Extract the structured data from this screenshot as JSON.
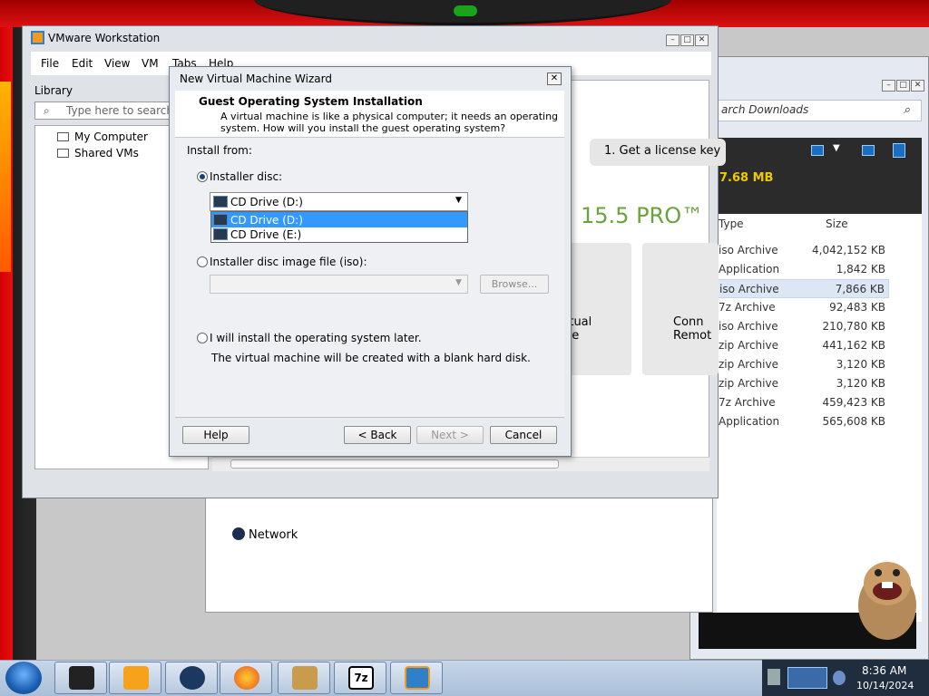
{
  "vmware": {
    "title": "VMware Workstation",
    "menu": [
      "File",
      "Edit",
      "View",
      "VM",
      "Tabs",
      "Help"
    ],
    "library_label": "Library",
    "search_placeholder": "Type here to search",
    "tree": [
      "My Computer",
      "Shared VMs"
    ],
    "home": {
      "license_button": "1. Get a license key",
      "product": "15.5 PRO™",
      "tile1": "rtual",
      "tile1_line2": "ne",
      "tile2": "Conn",
      "tile2_line2": "Remot"
    }
  },
  "wizard": {
    "title": "New Virtual Machine Wizard",
    "heading": "Guest Operating System Installation",
    "subtitle_line1": "A virtual machine is like a physical computer; it needs an operating",
    "subtitle_line2": "system. How will you install the guest operating system?",
    "install_from": "Install from:",
    "option_disc": "Installer disc:",
    "disc_selected": "CD Drive (D:)",
    "disc_options": [
      "CD Drive (D:)",
      "CD Drive (E:)"
    ],
    "option_iso": "Installer disc image file (iso):",
    "browse": "Browse...",
    "option_later": "I will install the operating system later.",
    "later_desc": "The virtual machine will be created with a blank hard disk.",
    "help": "Help",
    "back": "< Back",
    "next": "Next >",
    "cancel": "Cancel"
  },
  "explorer": {
    "search": "arch Downloads",
    "size_banner": "7.68 MB",
    "col_type": "Type",
    "col_size": "Size",
    "rows": [
      {
        "type": "iso Archive",
        "size": "4,042,152 KB"
      },
      {
        "type": "Application",
        "size": "1,842 KB"
      },
      {
        "type": "iso Archive",
        "size": "7,866 KB"
      },
      {
        "type": "7z Archive",
        "size": "92,483 KB"
      },
      {
        "type": "iso Archive",
        "size": "210,780 KB"
      },
      {
        "type": "zip Archive",
        "size": "441,162 KB"
      },
      {
        "type": "zip Archive",
        "size": "3,120 KB"
      },
      {
        "type": "zip Archive",
        "size": "3,120 KB"
      },
      {
        "type": "7z Archive",
        "size": "459,423 KB"
      },
      {
        "type": "Application",
        "size": "565,608 KB"
      }
    ]
  },
  "middle_window": {
    "network": "Network"
  },
  "taskbar": {
    "time": "8:36 AM",
    "date": "10/14/2024",
    "apps": [
      "app1-icon",
      "vlc-icon",
      "app3-icon",
      "firefox-icon",
      "folder-icon",
      "7zip-icon",
      "vmware-icon"
    ]
  }
}
